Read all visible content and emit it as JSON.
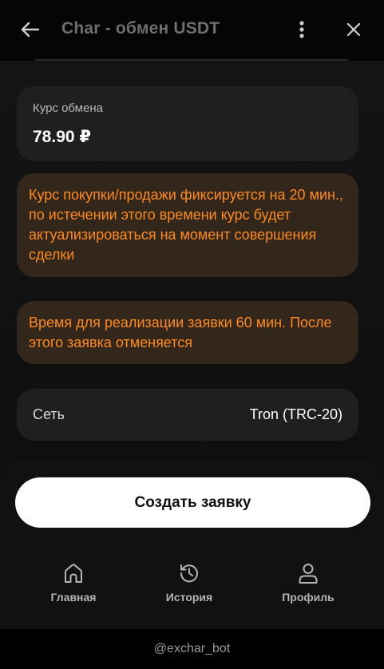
{
  "header": {
    "title": "Char - обмен USDT",
    "back_icon": "arrow-left-icon",
    "menu_icon": "kebab-menu-icon",
    "close_icon": "close-icon"
  },
  "rate": {
    "label": "Курс обмена",
    "value": "78.90 ₽"
  },
  "notices": {
    "rate_fixed": "Курс покупки/продажи фиксируется на 20 мин., по истечении этого времени курс будет актуализироваться на момент совершения сделки",
    "time_limit": "Время для реализации заявки 60 мин. После этого заявка отменяется"
  },
  "network": {
    "label": "Сеть",
    "value": "Tron (TRC-20)"
  },
  "actions": {
    "create_label": "Создать заявку"
  },
  "nav": {
    "home": "Главная",
    "history": "История",
    "profile": "Профиль"
  },
  "footer": {
    "bot_handle": "@exchar_bot"
  },
  "colors": {
    "notice_text": "#ff8a1f",
    "notice_bg": "#33271b",
    "card_bg": "#1f1f1f",
    "button_bg": "#ffffff"
  }
}
